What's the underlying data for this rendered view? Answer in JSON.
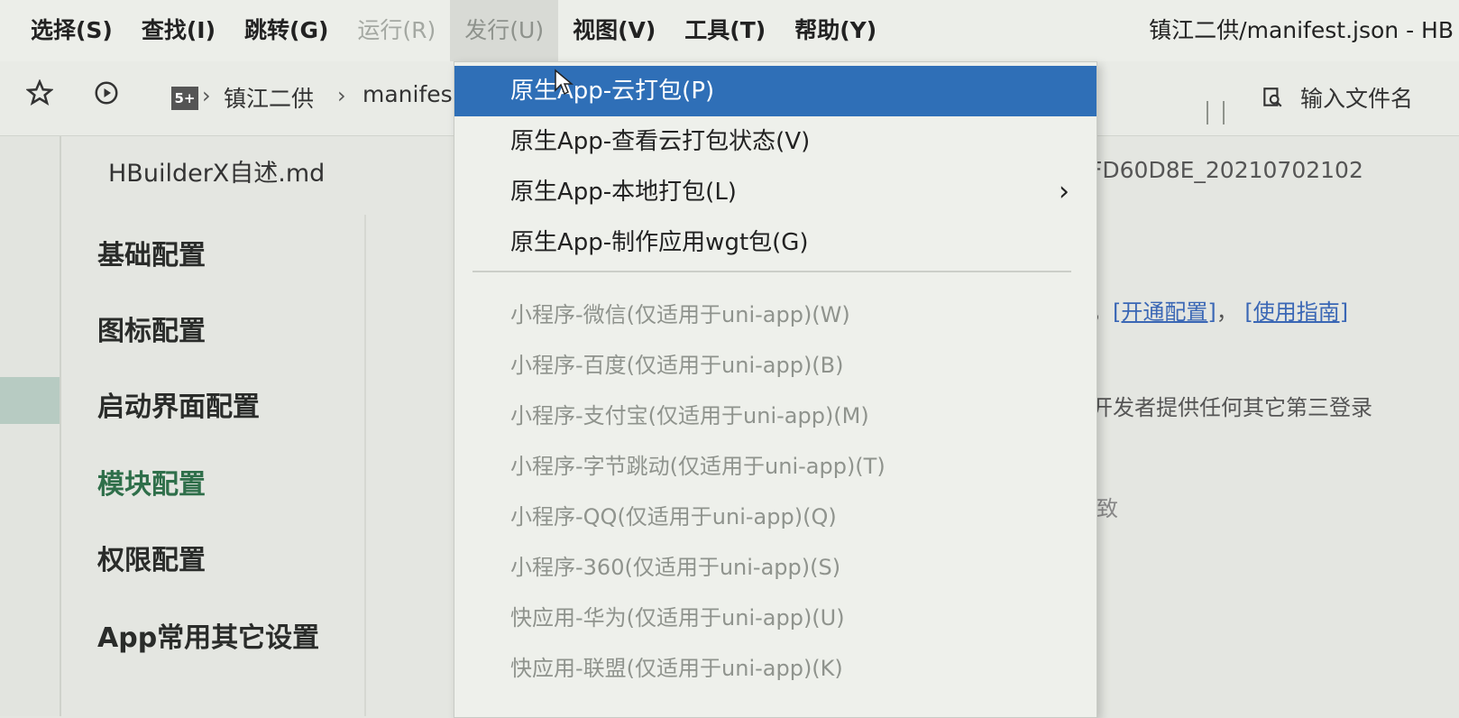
{
  "menubar": {
    "items": [
      {
        "label": "选择(S)"
      },
      {
        "label": "查找(I)"
      },
      {
        "label": "跳转(G)"
      },
      {
        "label": "运行(R)"
      },
      {
        "label": "发行(U)"
      },
      {
        "label": "视图(V)"
      },
      {
        "label": "工具(T)"
      },
      {
        "label": "帮助(Y)"
      }
    ],
    "window_title": "镇江二供/manifest.json - HB"
  },
  "toolbar": {
    "star_icon": "star-icon",
    "play_icon": "play-circle-icon",
    "project_badge": "5+",
    "breadcrumb": [
      "镇江二供",
      "manifes"
    ],
    "quick_open_placeholder": "输入文件名"
  },
  "editor": {
    "open_file": "HBuilderX自述.md",
    "nav_items": [
      {
        "label": "基础配置"
      },
      {
        "label": "图标配置"
      },
      {
        "label": "启动界面配置"
      },
      {
        "label": "模块配置"
      },
      {
        "label": "权限配置"
      },
      {
        "label": "App常用其它设置"
      }
    ],
    "background_text": {
      "id_fragment": "FD60D8E_20210702102",
      "link_prefix": "，",
      "link_open_config": "[开通配置]",
      "link_sep": "，",
      "link_guide": "[使用指南]",
      "third_party_fragment": "开发者提供任何其它第三登录",
      "consistent_fragment": "致"
    }
  },
  "dropdown": {
    "items": [
      {
        "label": "原生App-云打包(P)",
        "enabled": true
      },
      {
        "label": "原生App-查看云打包状态(V)",
        "enabled": true
      },
      {
        "label": "原生App-本地打包(L)",
        "enabled": true,
        "submenu": "chevron-right-icon"
      },
      {
        "label": "原生App-制作应用wgt包(G)",
        "enabled": true
      },
      {
        "label": "小程序-微信(仅适用于uni-app)(W)",
        "enabled": false
      },
      {
        "label": "小程序-百度(仅适用于uni-app)(B)",
        "enabled": false
      },
      {
        "label": "小程序-支付宝(仅适用于uni-app)(M)",
        "enabled": false
      },
      {
        "label": "小程序-字节跳动(仅适用于uni-app)(T)",
        "enabled": false
      },
      {
        "label": "小程序-QQ(仅适用于uni-app)(Q)",
        "enabled": false
      },
      {
        "label": "小程序-360(仅适用于uni-app)(S)",
        "enabled": false
      },
      {
        "label": "快应用-华为(仅适用于uni-app)(U)",
        "enabled": false
      },
      {
        "label": "快应用-联盟(仅适用于uni-app)(K)",
        "enabled": false
      }
    ],
    "highlight_color": "#2f6fb7"
  }
}
